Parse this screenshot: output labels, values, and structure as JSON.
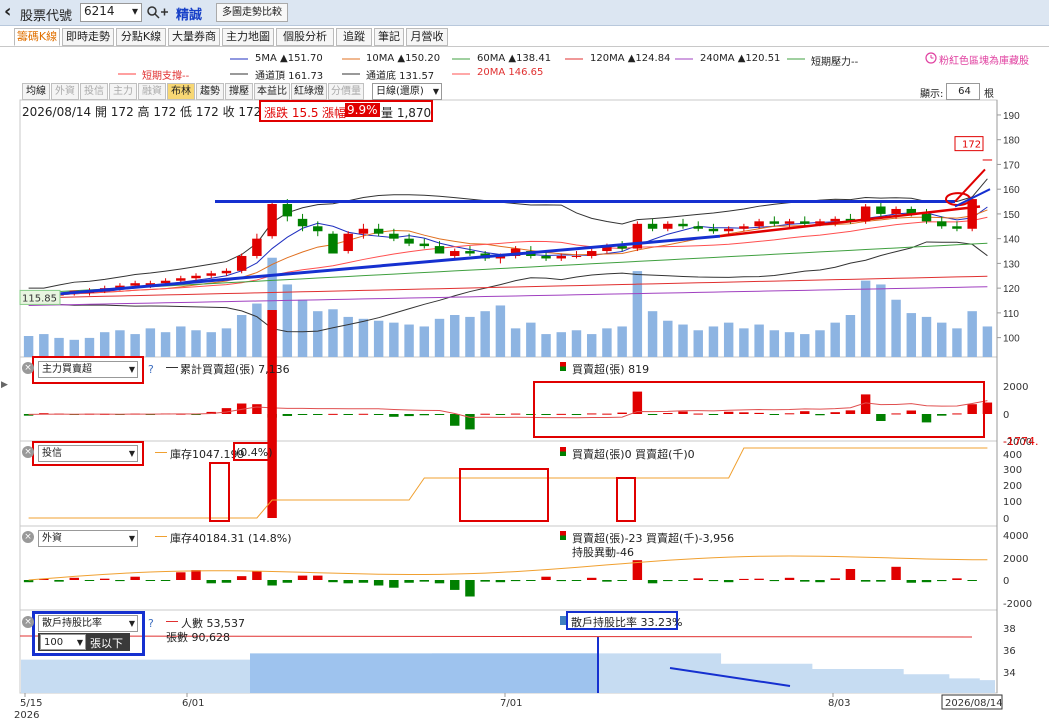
{
  "topbar": {
    "back_glyph": "‹",
    "stock_code_label": "股票代號",
    "stock_code_value": "6214",
    "search_glyph": "▾",
    "stock_name": "精誠",
    "compare_button": "多圖走勢比較"
  },
  "tabs": [
    "籌碼K線",
    "即時走勢",
    "分點K線",
    "大量券商",
    "主力地圖",
    "個股分析",
    "追蹤",
    "筆記",
    "月營收"
  ],
  "legend": {
    "ma5": "5MA ▲151.70",
    "ma10": "10MA ▲150.20",
    "ma60": "60MA ▲138.41",
    "ma120": "120MA ▲124.84",
    "ma240": "240MA ▲120.51",
    "short_pressure": "短期壓力--",
    "short_support": "短期支撐--",
    "channel_top": "通道頂 161.73",
    "channel_bottom": "通道底 131.57",
    "ma20": "20MA 146.65",
    "note": "粉紅色區塊為庫藏股",
    "note_icon": "clock-icon",
    "colors": {
      "ma5": "#2030c0",
      "ma10": "#e07020",
      "ma60": "#40a040",
      "ma120": "#e03030",
      "ma240": "#a040c0",
      "short": "#40a040",
      "ma20": "#ff5050"
    }
  },
  "chart_toolbar": {
    "buttons": [
      "均線",
      "外資",
      "投信",
      "主力",
      "融資",
      "布林",
      "趨勢",
      "撐壓",
      "本益比",
      "紅綠燈",
      "分價量"
    ],
    "period_select": "日線(還原)",
    "display_label": "顯示:",
    "display_value": "64",
    "display_unit": "根"
  },
  "quote": {
    "text": "2026/08/14 開 172 高 172 低 172 收 172",
    "change_label": "漲跌 15.5",
    "pct_label": "漲幅",
    "pct_value": "9.9%",
    "volume": "量 1,870"
  },
  "price_axis": [
    "190",
    "180",
    "170",
    "160",
    "150",
    "140",
    "130",
    "120",
    "110",
    "100"
  ],
  "price_tag": "172",
  "left_price_tag": "115.85",
  "panel_main_force": {
    "select": "主力買賣超",
    "help": "?",
    "cum_label": "累計買賣超(張) 7,136",
    "net_label": "買賣超(張) 819",
    "axis": [
      "2000",
      "0",
      "-2000"
    ],
    "extra": "-1774."
  },
  "panel_trust": {
    "select": "投信",
    "inventory": "庫存1047.199",
    "inventory_pct": "(0.4%)",
    "net_label": "買賣超(張)0 買賣超(千)0",
    "axis": [
      "400",
      "300",
      "200",
      "100",
      "0"
    ]
  },
  "panel_foreign": {
    "select": "外資",
    "inventory": "庫存40184.31 (14.8%)",
    "net_label": "買賣超(張)-23 買賣超(千)-3,956",
    "change_label": "持股異動-46",
    "axis": [
      "4000",
      "2000",
      "0",
      "-2000"
    ]
  },
  "panel_retail": {
    "select": "散戶持股比率",
    "sub_select": "100",
    "sub_unit": "張以下",
    "help": "?",
    "people_label": "人數 53,537",
    "shares_label": "張數 90,628",
    "ratio_label": "散戶持股比率 33.23%",
    "axis": [
      "38",
      "36",
      "34"
    ]
  },
  "x_axis": {
    "labels": [
      "5/15",
      "6/01",
      "7/01",
      "8/03"
    ],
    "year": "2026",
    "last": "2026/08/14"
  },
  "chart_data": {
    "type": "candlestick",
    "dates_axis": [
      "5/15",
      "6/01",
      "7/01",
      "8/03",
      "2026/08/14"
    ],
    "ylim": [
      95,
      192
    ],
    "candles": [
      [
        117,
        118,
        116,
        117
      ],
      [
        117,
        118,
        116,
        117
      ],
      [
        117,
        119,
        116,
        118
      ],
      [
        118,
        119,
        117,
        119
      ],
      [
        118,
        120,
        117,
        119
      ],
      [
        119,
        121,
        118,
        120
      ],
      [
        120,
        122,
        119,
        121
      ],
      [
        121,
        123,
        120,
        122
      ],
      [
        121,
        123,
        120,
        122
      ],
      [
        122,
        124,
        121,
        123
      ],
      [
        123,
        125,
        122,
        124
      ],
      [
        124,
        126,
        123,
        125
      ],
      [
        125,
        127,
        124,
        126
      ],
      [
        126,
        128,
        125,
        127
      ],
      [
        127,
        134,
        126,
        133
      ],
      [
        133,
        142,
        132,
        140
      ],
      [
        141,
        155,
        140,
        154
      ],
      [
        154,
        156,
        147,
        149
      ],
      [
        148,
        150,
        143,
        145
      ],
      [
        145,
        147,
        141,
        143
      ],
      [
        142,
        143,
        134,
        134
      ],
      [
        135,
        143,
        134,
        142
      ],
      [
        142,
        146,
        140,
        144
      ],
      [
        144,
        146,
        141,
        142
      ],
      [
        142,
        144,
        139,
        140
      ],
      [
        140,
        142,
        137,
        138
      ],
      [
        138,
        140,
        136,
        137
      ],
      [
        137,
        139,
        134,
        134
      ],
      [
        133,
        136,
        132,
        135
      ],
      [
        135,
        137,
        133,
        134
      ],
      [
        134,
        135,
        131,
        132
      ],
      [
        132,
        134,
        130,
        133
      ],
      [
        133,
        137,
        132,
        136
      ],
      [
        135,
        137,
        132,
        133
      ],
      [
        133,
        135,
        131,
        132
      ],
      [
        132,
        134,
        131,
        133
      ],
      [
        133,
        135,
        132,
        133
      ],
      [
        133,
        136,
        132,
        135
      ],
      [
        135,
        138,
        134,
        137
      ],
      [
        137,
        139,
        135,
        136
      ],
      [
        136,
        147,
        135,
        146
      ],
      [
        146,
        148,
        143,
        144
      ],
      [
        144,
        147,
        143,
        146
      ],
      [
        146,
        148,
        144,
        145
      ],
      [
        145,
        147,
        143,
        144
      ],
      [
        144,
        146,
        142,
        143
      ],
      [
        143,
        145,
        141,
        144
      ],
      [
        144,
        146,
        143,
        145
      ],
      [
        145,
        148,
        144,
        147
      ],
      [
        147,
        149,
        145,
        146
      ],
      [
        146,
        148,
        144,
        147
      ],
      [
        147,
        149,
        145,
        146
      ],
      [
        146,
        148,
        145,
        147
      ],
      [
        147,
        149,
        145,
        148
      ],
      [
        148,
        150,
        146,
        147
      ],
      [
        147,
        154,
        146,
        153
      ],
      [
        153,
        155,
        149,
        150
      ],
      [
        150,
        153,
        148,
        152
      ],
      [
        152,
        153,
        149,
        150
      ],
      [
        150,
        152,
        146,
        147
      ],
      [
        147,
        149,
        144,
        145
      ],
      [
        145,
        147,
        143,
        144
      ],
      [
        144,
        157,
        143,
        156
      ],
      [
        172,
        172,
        172,
        172
      ]
    ],
    "volume": [
      11,
      12,
      10,
      9,
      10,
      13,
      14,
      12,
      15,
      13,
      16,
      14,
      13,
      15,
      22,
      28,
      52,
      38,
      30,
      24,
      25,
      21,
      20,
      19,
      18,
      17,
      16,
      20,
      22,
      21,
      24,
      27,
      15,
      18,
      12,
      13,
      14,
      12,
      15,
      16,
      45,
      24,
      19,
      17,
      14,
      16,
      18,
      15,
      17,
      14,
      13,
      12,
      14,
      18,
      22,
      40,
      38,
      30,
      23,
      21,
      18,
      15,
      24,
      16
    ],
    "main_force": [
      -120,
      60,
      30,
      -40,
      20,
      10,
      -20,
      30,
      -10,
      40,
      20,
      -30,
      150,
      420,
      750,
      700,
      -260,
      -140,
      -20,
      -60,
      10,
      -40,
      15,
      -30,
      -200,
      -150,
      -90,
      -60,
      -840,
      -1100,
      20,
      -40,
      30,
      -20,
      -70,
      10,
      -30,
      40,
      25,
      100,
      1600,
      -20,
      70,
      180,
      30,
      -60,
      160,
      120,
      80,
      -40,
      50,
      200,
      -90,
      130,
      260,
      1400,
      -500,
      40,
      250,
      -600,
      -120,
      40,
      700,
      819
    ],
    "trust": [
      0,
      0,
      0,
      0,
      0,
      0,
      0,
      0,
      0,
      0,
      0,
      0,
      0,
      0,
      0,
      0,
      400,
      0,
      0,
      0,
      0,
      0,
      0,
      0,
      0,
      0,
      0,
      0,
      0,
      0,
      0,
      0,
      0,
      0,
      0,
      0,
      0,
      0,
      0,
      0,
      0,
      0,
      0,
      0,
      0,
      0,
      0,
      0,
      0,
      0,
      0,
      0,
      0,
      0,
      0,
      0,
      0,
      0,
      0,
      0,
      0,
      0,
      0,
      0
    ],
    "foreign": [
      -200,
      100,
      -150,
      200,
      -50,
      120,
      -100,
      300,
      -80,
      -60,
      700,
      900,
      -300,
      -250,
      350,
      800,
      -500,
      -250,
      400,
      400,
      -200,
      -300,
      -250,
      -500,
      -700,
      -250,
      -150,
      -300,
      -900,
      -1500,
      -150,
      -200,
      -100,
      -80,
      300,
      -100,
      -50,
      200,
      -150,
      -60,
      1800,
      -300,
      -100,
      -50,
      150,
      -100,
      -200,
      100,
      120,
      -100,
      200,
      -150,
      -200,
      150,
      1000,
      -150,
      -150,
      1200,
      -250,
      -200,
      -100,
      150,
      -23,
      0
    ],
    "retail_ratio": [
      35.2,
      35.2,
      35.2,
      35.2,
      35.2,
      35.2,
      35.2,
      35.2,
      35.2,
      35.2,
      35.2,
      35.2,
      35.2,
      35.2,
      35.2,
      35.2,
      35.2,
      35.2,
      35.2,
      35.2,
      35.2,
      35.2,
      35.2,
      35.2,
      35.2,
      35.2,
      35.2,
      35.8,
      35.8,
      35.8,
      35.8,
      35.8,
      35.8,
      35.8,
      35.8,
      35.8,
      35.8,
      35.8,
      35.8,
      35.8,
      35.8,
      35.8,
      35.8,
      35.8,
      35.8,
      35.8,
      34.8,
      34.8,
      34.8,
      34.8,
      34.8,
      34.8,
      34.3,
      34.3,
      34.3,
      34.3,
      34.3,
      34.3,
      33.8,
      33.8,
      33.8,
      33.4,
      33.4,
      33.23
    ]
  }
}
